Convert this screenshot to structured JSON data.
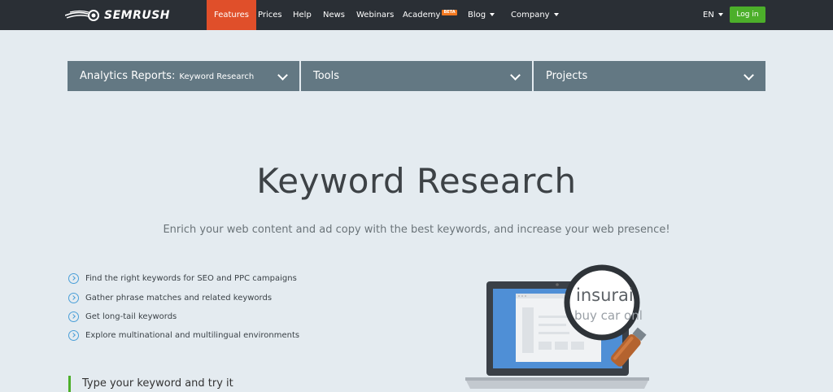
{
  "brand": {
    "name": "SEMRUSH",
    "logo_icon": "fire-swoosh-icon"
  },
  "nav": {
    "items": [
      {
        "label": "Features",
        "active": true
      },
      {
        "label": "Prices"
      },
      {
        "label": "Help"
      },
      {
        "label": "News"
      },
      {
        "label": "Webinars"
      },
      {
        "label": "Academy",
        "badge": "BETA"
      },
      {
        "label": "Blog",
        "dropdown": true
      },
      {
        "label": "Company",
        "dropdown": true
      }
    ],
    "language": "EN",
    "login_label": "Log in"
  },
  "dropdowns": {
    "analytics": {
      "label": "Analytics Reports:",
      "value": "Keyword Research"
    },
    "tools": {
      "label": "Tools"
    },
    "projects": {
      "label": "Projects"
    }
  },
  "hero": {
    "title": "Keyword Research",
    "subtitle": "Enrich your web content and ad copy with the best keywords, and increase your web presence!"
  },
  "features": [
    "Find the right keywords for SEO and PPC campaigns",
    "Gather phrase matches and related keywords",
    "Get long-tail keywords",
    "Explore multinational and multilingual environments"
  ],
  "try_heading": "Type your keyword and try it",
  "illustration": {
    "magnifier_line1": "insurai",
    "magnifier_line2": "buy car onl"
  },
  "colors": {
    "nav_bg": "#2a2f35",
    "active": "#e04f2a",
    "login": "#4caf2a",
    "dropdown_bg": "#637883",
    "page_bg": "#e4ebf0"
  }
}
